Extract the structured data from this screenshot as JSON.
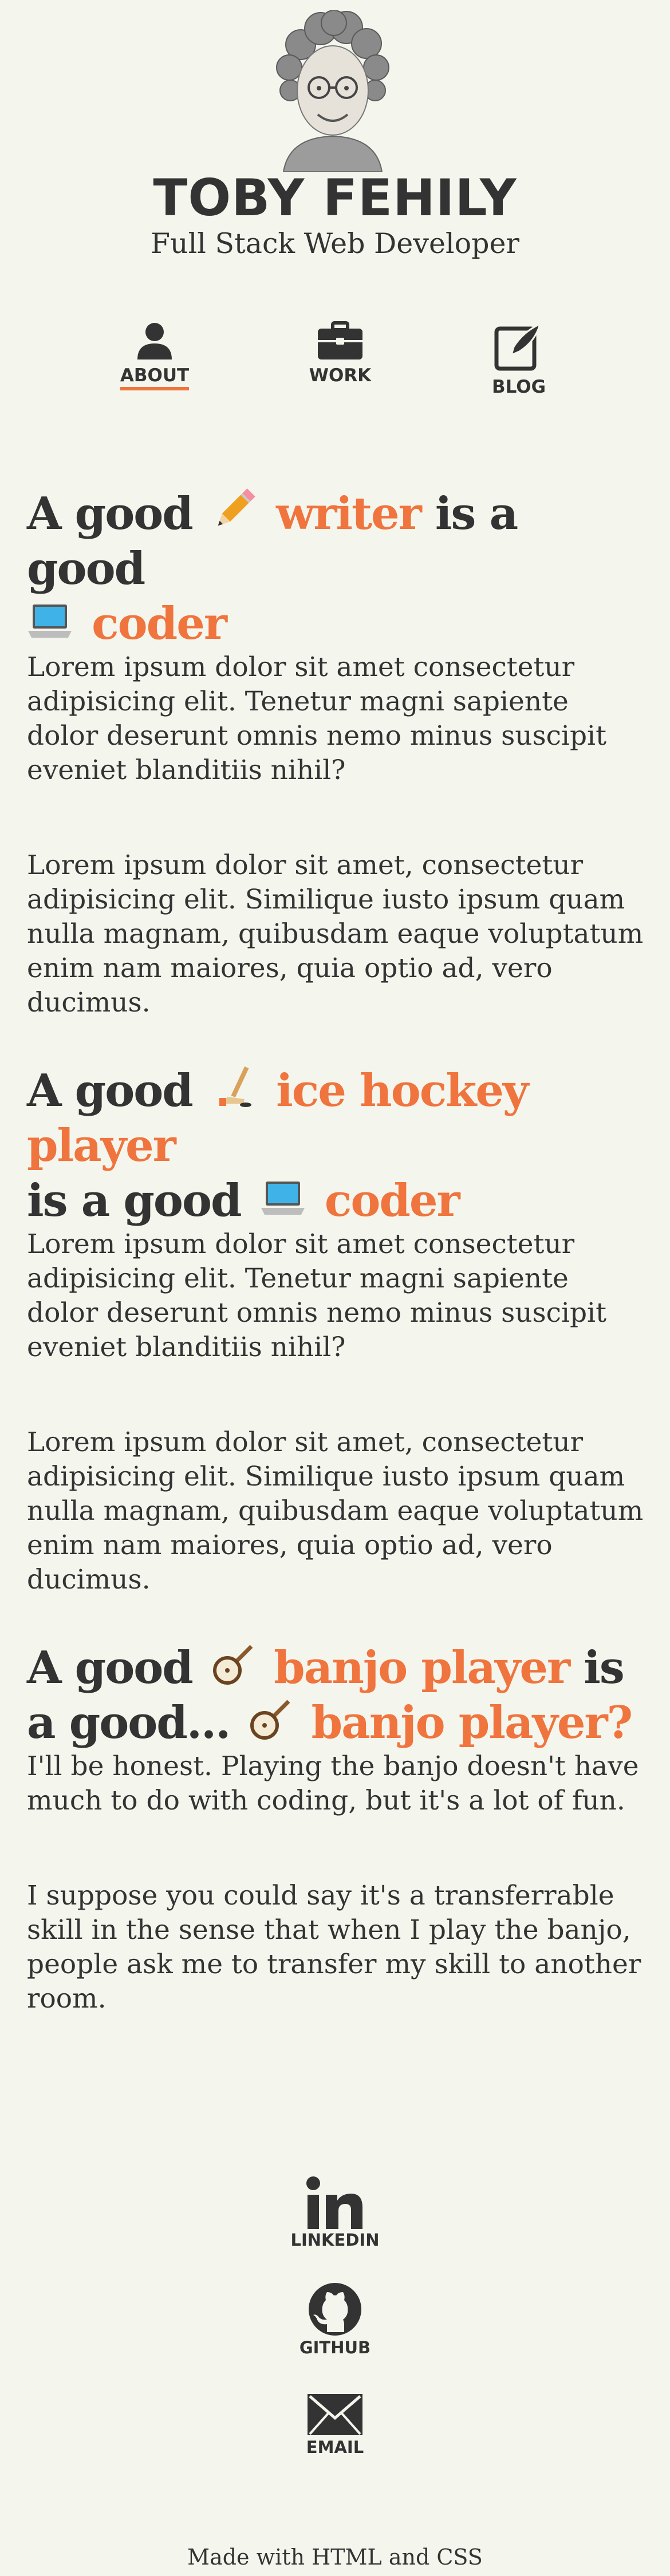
{
  "header": {
    "name": "TOBY FEHILY",
    "subtitle": "Full Stack Web Developer"
  },
  "nav": {
    "items": [
      {
        "label": "ABOUT",
        "icon": "person-icon",
        "active": true
      },
      {
        "label": "WORK",
        "icon": "briefcase-icon",
        "active": false
      },
      {
        "label": "BLOG",
        "icon": "edit-icon",
        "active": false
      }
    ]
  },
  "sections": [
    {
      "heading": {
        "a": "A good",
        "b": "writer",
        "c": "is a good",
        "d": "coder"
      },
      "paragraphs": [
        "Lorem ipsum dolor sit amet consectetur adipisicing elit. Tenetur magni sapiente dolor deserunt omnis nemo minus suscipit eveniet blanditiis nihil?",
        "Lorem ipsum dolor sit amet, consectetur adipisicing elit. Similique iusto ipsum quam nulla magnam, quibusdam eaque voluptatum enim nam maiores, quia optio ad, vero ducimus."
      ]
    },
    {
      "heading": {
        "a": "A good",
        "b": "ice hockey player",
        "c": "is a good",
        "d": "coder"
      },
      "paragraphs": [
        "Lorem ipsum dolor sit amet consectetur adipisicing elit. Tenetur magni sapiente dolor deserunt omnis nemo minus suscipit eveniet blanditiis nihil?",
        "Lorem ipsum dolor sit amet, consectetur adipisicing elit. Similique iusto ipsum quam nulla magnam, quibusdam eaque voluptatum enim nam maiores, quia optio ad, vero ducimus."
      ]
    },
    {
      "heading": {
        "a": "A good",
        "b": "banjo player",
        "c": "is a good...",
        "d": "banjo player?"
      },
      "paragraphs": [
        "I'll be honest. Playing the banjo doesn't have much to do with coding, but it's a lot of fun.",
        "I suppose you could say it's a transferrable skill in the sense that when I play the banjo, people ask me to transfer my skill to another room."
      ]
    }
  ],
  "social": {
    "linkedin": "LINKEDIN",
    "github": "GITHUB",
    "email": "EMAIL"
  },
  "footer": {
    "made_with": "Made with HTML and CSS"
  },
  "colors": {
    "background": "#f4f6ed",
    "text": "#333333",
    "accent": "#f0743e"
  }
}
